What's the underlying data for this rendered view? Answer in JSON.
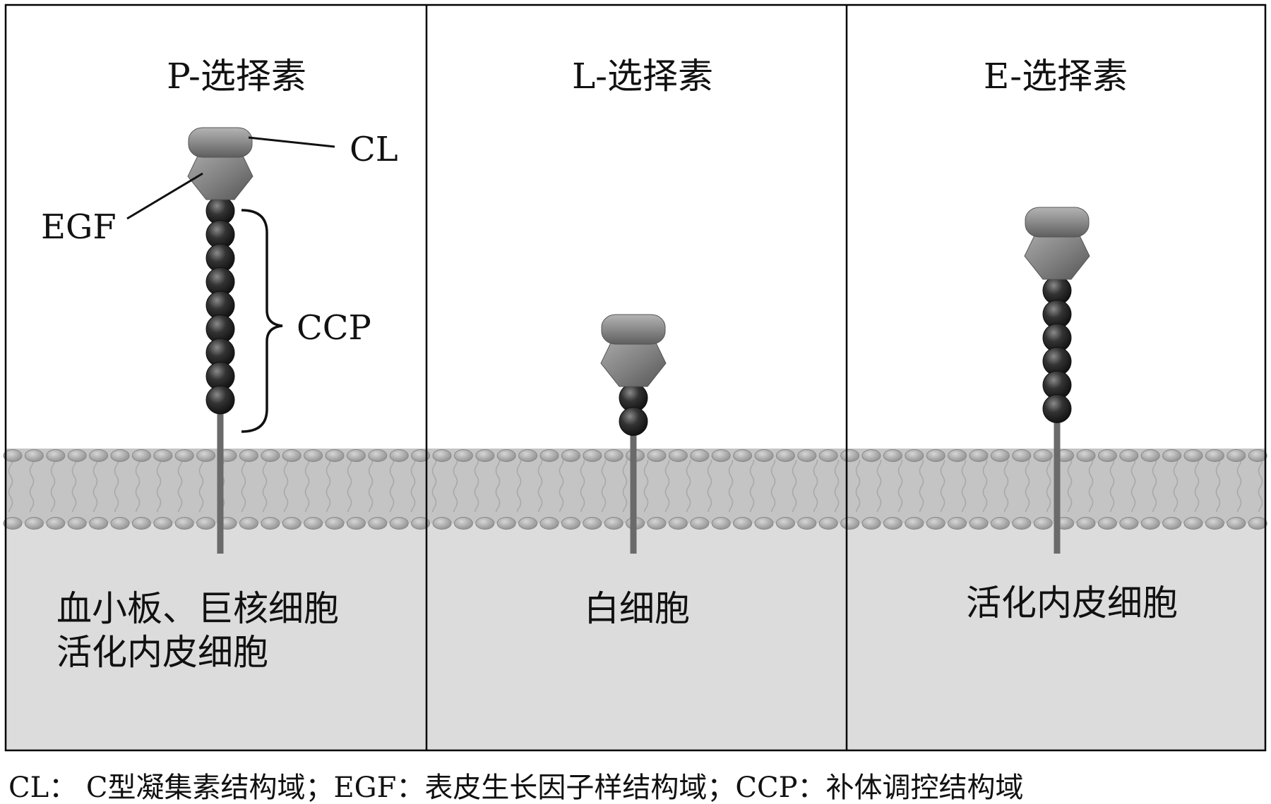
{
  "panels": [
    {
      "title": "P-选择素",
      "cell_lines": [
        "血小板、巨核细胞",
        "活化内皮细胞"
      ],
      "ccp_count": 9,
      "annotations": {
        "cl": "CL",
        "egf": "EGF",
        "ccp": "CCP"
      }
    },
    {
      "title": "L-选择素",
      "cell_lines": [
        "白细胞"
      ],
      "ccp_count": 2
    },
    {
      "title": "E-选择素",
      "cell_lines": [
        "活化内皮细胞"
      ],
      "ccp_count": 6
    }
  ],
  "caption": "CL： C型凝集素结构域；EGF：表皮生长因子样结构域；CCP：补体调控结构域",
  "colors": {
    "membrane_fill": "#c4c4c4",
    "cytoplasm_fill": "#dcdcdc",
    "head_gray": "#8c8c8c",
    "bead_dark": "#2b2b2b",
    "border": "#000000"
  }
}
